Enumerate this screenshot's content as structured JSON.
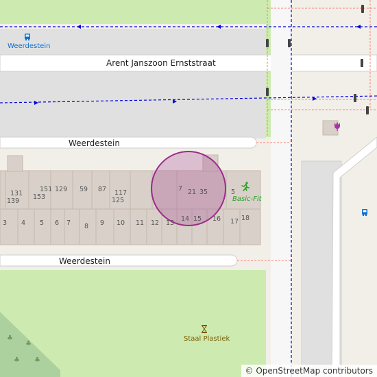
{
  "map": {
    "streets": {
      "arent": "Arent Janszoon Ernststraat",
      "weerdestein_north": "Weerdestein",
      "weerdestein_south": "Weerdestein"
    },
    "pois": {
      "bus_stop_label": "Weerdestein",
      "gym_label": "Basic-Fit",
      "shop_label": "Staal Plastiek"
    },
    "house_numbers": [
      "131",
      "139",
      "151",
      "153",
      "129",
      "59",
      "87",
      "117",
      "125",
      "7",
      "21",
      "35",
      "5",
      "3",
      "4",
      "5",
      "6",
      "7",
      "8",
      "9",
      "10",
      "11",
      "12",
      "13",
      "14",
      "15",
      "16",
      "17",
      "18"
    ],
    "attribution": "© OpenStreetMap contributors",
    "colors": {
      "land": "#f2efe9",
      "grass": "#cdebb0",
      "building": "#d9d0c9",
      "road": "#ffffff",
      "parking": "#e0e0e0",
      "cycleway": "#0000dc",
      "footway": "#fa8072",
      "highlight": "#9b2b8a",
      "gym": "#2aa12a",
      "bus": "#0b6fd4"
    }
  }
}
